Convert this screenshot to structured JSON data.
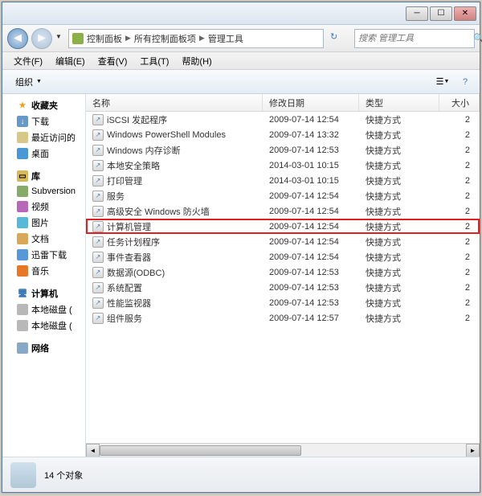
{
  "window": {
    "title": ""
  },
  "breadcrumb": {
    "parts": [
      "控制面板",
      "所有控制面板项",
      "管理工具"
    ]
  },
  "search": {
    "placeholder": "搜索 管理工具"
  },
  "menubar": {
    "file": "文件(F)",
    "edit": "编辑(E)",
    "view": "查看(V)",
    "tools": "工具(T)",
    "help": "帮助(H)"
  },
  "toolbar": {
    "organize": "组织"
  },
  "sidebar": {
    "favorites": {
      "label": "收藏夹",
      "items": [
        "下载",
        "最近访问的",
        "桌面"
      ]
    },
    "libraries": {
      "label": "库",
      "items": [
        "Subversion",
        "视频",
        "图片",
        "文档",
        "迅雷下载",
        "音乐"
      ]
    },
    "computer": {
      "label": "计算机",
      "items": [
        "本地磁盘 (",
        "本地磁盘 ("
      ]
    },
    "network": {
      "label": "网络"
    }
  },
  "columns": {
    "name": "名称",
    "date": "修改日期",
    "type": "类型",
    "size": "大小"
  },
  "files": [
    {
      "name": "iSCSI 发起程序",
      "date": "2009-07-14 12:54",
      "type": "快捷方式",
      "size": "2"
    },
    {
      "name": "Windows PowerShell Modules",
      "date": "2009-07-14 13:32",
      "type": "快捷方式",
      "size": "2"
    },
    {
      "name": "Windows 内存诊断",
      "date": "2009-07-14 12:53",
      "type": "快捷方式",
      "size": "2"
    },
    {
      "name": "本地安全策略",
      "date": "2014-03-01 10:15",
      "type": "快捷方式",
      "size": "2"
    },
    {
      "name": "打印管理",
      "date": "2014-03-01 10:15",
      "type": "快捷方式",
      "size": "2"
    },
    {
      "name": "服务",
      "date": "2009-07-14 12:54",
      "type": "快捷方式",
      "size": "2"
    },
    {
      "name": "高级安全 Windows 防火墙",
      "date": "2009-07-14 12:54",
      "type": "快捷方式",
      "size": "2"
    },
    {
      "name": "计算机管理",
      "date": "2009-07-14 12:54",
      "type": "快捷方式",
      "size": "2",
      "highlight": true
    },
    {
      "name": "任务计划程序",
      "date": "2009-07-14 12:54",
      "type": "快捷方式",
      "size": "2"
    },
    {
      "name": "事件查看器",
      "date": "2009-07-14 12:54",
      "type": "快捷方式",
      "size": "2"
    },
    {
      "name": "数据源(ODBC)",
      "date": "2009-07-14 12:53",
      "type": "快捷方式",
      "size": "2"
    },
    {
      "name": "系统配置",
      "date": "2009-07-14 12:53",
      "type": "快捷方式",
      "size": "2"
    },
    {
      "name": "性能监视器",
      "date": "2009-07-14 12:53",
      "type": "快捷方式",
      "size": "2"
    },
    {
      "name": "组件服务",
      "date": "2009-07-14 12:57",
      "type": "快捷方式",
      "size": "2"
    }
  ],
  "status": {
    "count": "14 个对象"
  }
}
